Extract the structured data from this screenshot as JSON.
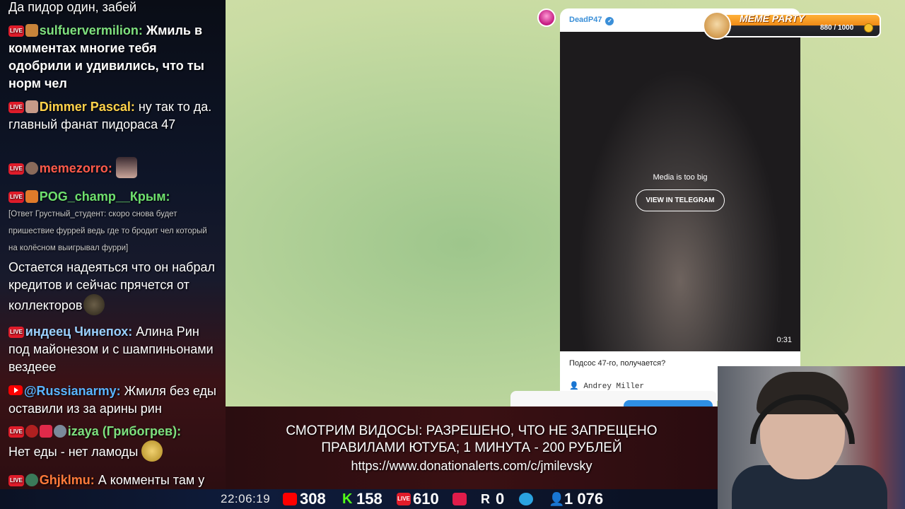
{
  "chat": {
    "messages": [
      {
        "text": "Да пидор один, забей"
      },
      {
        "platform": "LIVE",
        "nick": "sulfuervermilion:",
        "nick_color": "#7ee07e",
        "text": " Жмиль в комментах многие тебя одобрили и удивились, что ты норм чел"
      },
      {
        "platform": "LIVE",
        "nick": "Dimmer Pascal:",
        "nick_color": "#ffd24a",
        "text": " ну так то да. главный фанат пидораса 47"
      },
      {
        "platform": "LIVE",
        "nick": "memezorro:",
        "nick_color": "#ff5a4a",
        "text": ""
      },
      {
        "platform": "LIVE",
        "nick": "POG_champ__Крым:",
        "nick_color": "#6ee06e",
        "reply": "[Ответ Грустный_студент: скоро снова будет пришествие фуррей ведь где то бродит чел который на колёсном выигрывал фурри]",
        "text": "Остается надеяться что он набрал кредитов и сейчас прячется от коллекторов"
      },
      {
        "platform": "LIVE",
        "nick": "индеец Чинепох:",
        "nick_color": "#9ad0ff",
        "text": " Алина Рин под майонезом и с шампиньонами вездеее"
      },
      {
        "platform": "YouTube",
        "nick": "@Russianarmy:",
        "nick_color": "#5ab4ff",
        "text": " Жмиля без еды оставили из за арины рин"
      },
      {
        "platform": "LIVE",
        "nick": "izaya (Грибогрев):",
        "nick_color": "#7ee07e",
        "text": "Нет еды - нет ламоды"
      },
      {
        "platform": "LIVE",
        "nick": "Ghjklmu:",
        "nick_color": "#ff7a3a",
        "text": " А комменты там у него конечно"
      }
    ]
  },
  "telegram": {
    "channel": "DeadP47",
    "media_note": "Media is too big",
    "view_button": "VIEW IN TELEGRAM",
    "duration": "0:31",
    "caption": "Подсос 47-го, получается?",
    "author": "Andrey Miller"
  },
  "meme_party": {
    "title": "MEME PARTY",
    "count": "880 / 1000"
  },
  "banner": {
    "line1": "СМОТРИМ ВИДОСЫ: РАЗРЕШЕНО, ЧТО НЕ ЗАПРЕЩЕНО",
    "line2": "ПРАВИЛАМИ ЮТУБА; 1 МИНУТА - 200 РУБЛЕЙ",
    "line3": "https://www.donationalerts.com/c/jmilevsky"
  },
  "stats": {
    "time": "22:06:19",
    "youtube": "308",
    "kick": "158",
    "live": "610",
    "rutube": "0",
    "total": "1 076",
    "colors": {
      "youtube": "#ff0000",
      "kick": "#53fc18",
      "live": "#e01c2a",
      "telegram": "#2aa3e0",
      "viewers": "#4a9cff"
    }
  }
}
